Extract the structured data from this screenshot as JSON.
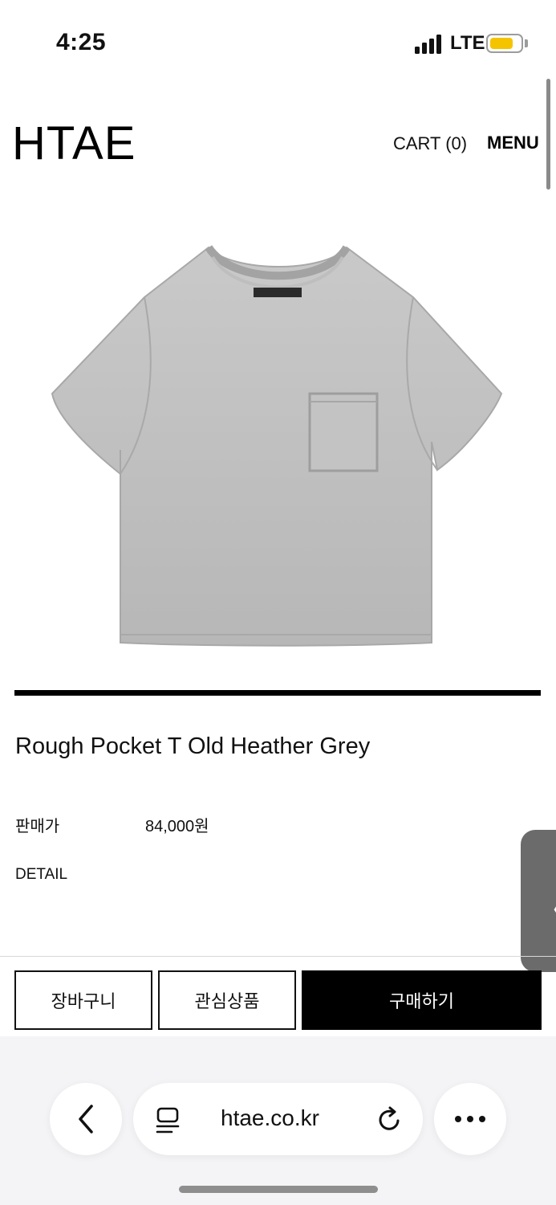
{
  "status_bar": {
    "time": "4:25",
    "network": "LTE",
    "battery_color": "#f5c400"
  },
  "header": {
    "logo": "HTAE",
    "cart_label": "CART (0)",
    "menu_label": "MENU"
  },
  "product": {
    "image_icon": "grey-pocket-tshirt",
    "title": "Rough Pocket T Old Heather Grey",
    "price_label": "판매가",
    "price_value": "84,000원",
    "detail_label": "DETAIL"
  },
  "side_tab": {
    "icon": "chevron-left-icon",
    "glyph": "〈"
  },
  "actions": {
    "cart_button": "장바구니",
    "wishlist_button": "관심상품",
    "buy_button": "구매하기"
  },
  "browser": {
    "url": "htae.co.kr",
    "back_icon": "chevron-left-icon",
    "reader_icon": "reader-icon",
    "reload_icon": "reload-icon",
    "more_icon": "more-icon"
  }
}
